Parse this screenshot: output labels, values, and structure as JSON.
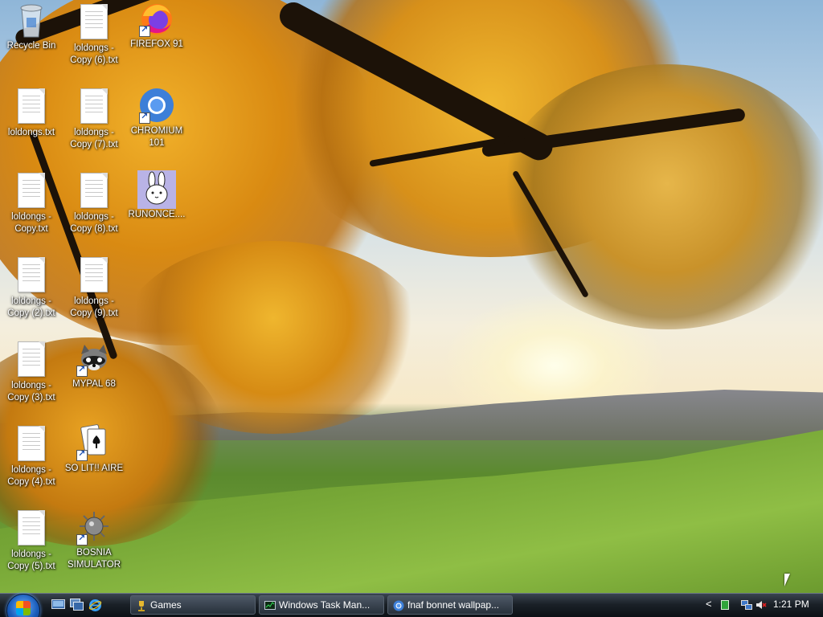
{
  "desktop": {
    "icons": [
      {
        "name": "recycle-bin",
        "label": "Recycle Bin"
      },
      {
        "name": "file-copy6",
        "label": "loldongs - Copy (6).txt"
      },
      {
        "name": "firefox",
        "label": "FIREFOX 91"
      },
      {
        "name": "file-loldongs",
        "label": "loldongs.txt"
      },
      {
        "name": "file-copy7",
        "label": "loldongs - Copy (7).txt"
      },
      {
        "name": "chromium",
        "label": "CHROMIUM 101"
      },
      {
        "name": "file-copy",
        "label": "loldongs - Copy.txt"
      },
      {
        "name": "file-copy8",
        "label": "loldongs - Copy (8).txt"
      },
      {
        "name": "runonce",
        "label": "RUNONCE...."
      },
      {
        "name": "file-copy2",
        "label": "loldongs - Copy (2).txt"
      },
      {
        "name": "file-copy9",
        "label": "loldongs - Copy (9).txt"
      },
      {
        "name": "file-copy3",
        "label": "loldongs - Copy (3).txt"
      },
      {
        "name": "mypal",
        "label": "MYPAL 68"
      },
      {
        "name": "file-copy4",
        "label": "loldongs - Copy (4).txt"
      },
      {
        "name": "solitaire",
        "label": "SO LIT!! AIRE"
      },
      {
        "name": "file-copy5",
        "label": "loldongs - Copy (5).txt"
      },
      {
        "name": "bosnia",
        "label": "BOSNIA SIMULATOR"
      }
    ]
  },
  "taskbar": {
    "start_icon": "windows-orb-icon",
    "quick_launch": [
      "show-desktop-icon",
      "switch-windows-icon",
      "internet-explorer-icon"
    ],
    "buttons": [
      {
        "label": "Games",
        "icon": "games-icon"
      },
      {
        "label": "Windows Task Man...",
        "icon": "task-manager-icon"
      },
      {
        "label": "fnaf bonnet wallpap...",
        "icon": "chromium-icon"
      }
    ],
    "tray": {
      "chevron": "<",
      "clock": "1:21 PM"
    }
  }
}
